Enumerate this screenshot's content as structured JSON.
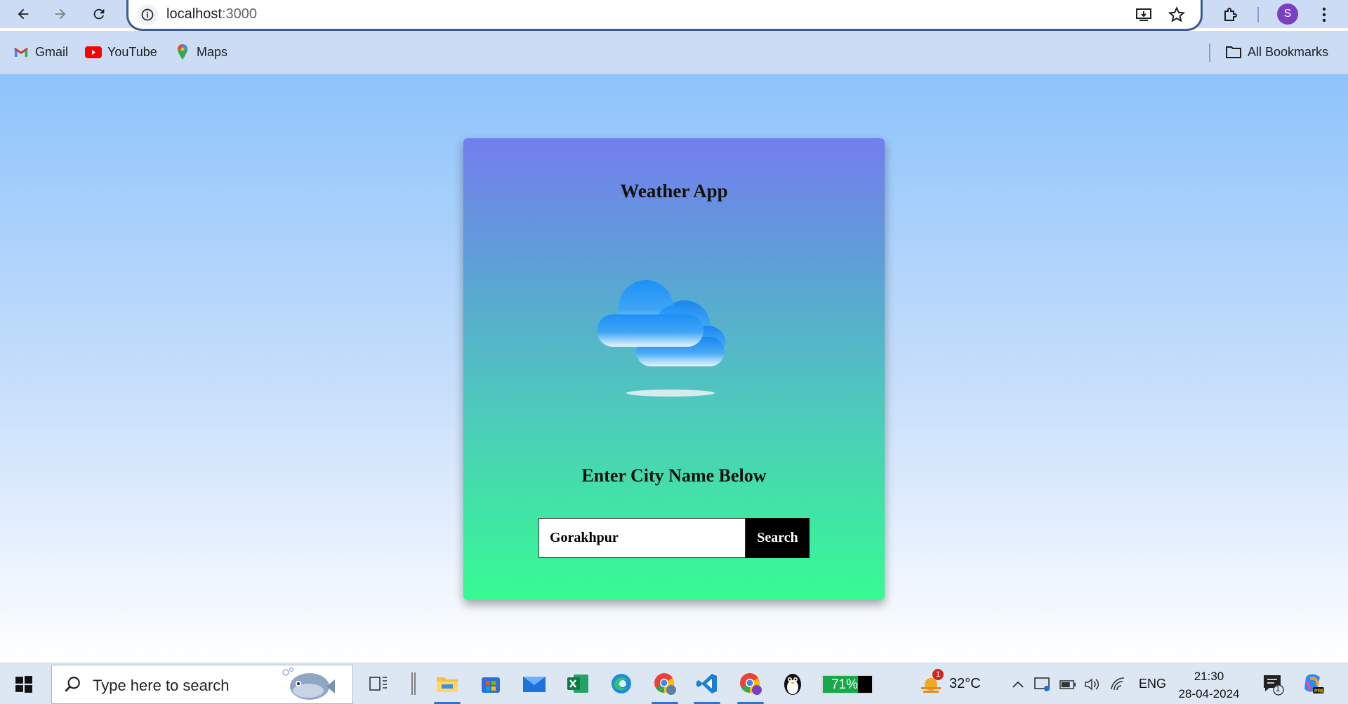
{
  "browser": {
    "url_host": "localhost",
    "url_port": ":3000",
    "profile_initial": "S",
    "bookmarks": [
      {
        "label": "Gmail",
        "icon": "gmail-icon"
      },
      {
        "label": "YouTube",
        "icon": "youtube-icon"
      },
      {
        "label": "Maps",
        "icon": "maps-icon"
      }
    ],
    "all_bookmarks_label": "All Bookmarks"
  },
  "app": {
    "title": "Weather App",
    "prompt": "Enter City Name Below",
    "city_value": "Gorakhpur",
    "search_label": "Search",
    "icon": "cloud-icon"
  },
  "taskbar": {
    "search_placeholder": "Type here to search",
    "battery_percent": "71%",
    "battery_level": 0.71,
    "weather_temp": "32°C",
    "weather_badge": "1",
    "language": "ENG",
    "time": "21:30",
    "date": "28-04-2024",
    "notification_count": "1"
  },
  "colors": {
    "page_top": "#8ec3fb",
    "card_top": "#737eee",
    "card_bottom": "#36fb92",
    "button_bg": "#000000"
  }
}
